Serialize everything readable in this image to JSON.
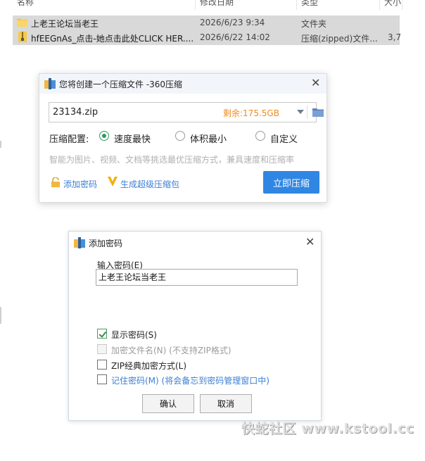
{
  "explorer": {
    "columns": [
      "名称",
      "修改日期",
      "类型",
      "大小"
    ],
    "rows": [
      {
        "name": "上老王论坛当老王",
        "date": "2026/6/23 9:34",
        "type": "文件夹",
        "size": ""
      },
      {
        "name": "hfEEGnAs_点击-她点击此处CLICK HER....",
        "date": "2026/6/22 14:02",
        "type": "压缩(zipped)文件...",
        "size": "3,7"
      }
    ]
  },
  "compress_dialog": {
    "title": "您将创建一个压缩文件 -360压缩",
    "filename": "23134.zip",
    "remaining": "剩余:175.5GB",
    "config_label": "压缩配置:",
    "options": [
      "速度最快",
      "体积最小",
      "自定义"
    ],
    "selected_option": "速度最快",
    "hint": "智能为图片、视频、文档等挑选最优压缩方式，兼具速度和压缩率",
    "add_password": "添加密码",
    "super_package": "生成超级压缩包",
    "compress_now": "立即压缩"
  },
  "password_dialog": {
    "title": "添加密码",
    "input_label": "输入密码(E)",
    "password_value": "上老王论坛当老王",
    "checkboxes": [
      {
        "label": "显示密码(S)",
        "checked": true,
        "enabled": true
      },
      {
        "label": "加密文件名(N) (不支持ZIP格式)",
        "checked": false,
        "enabled": false
      },
      {
        "label": "ZIP经典加密方式(L)",
        "checked": false,
        "enabled": true
      },
      {
        "label": "记住密码(M) (将会备忘到密码管理窗口中)",
        "checked": false,
        "enabled": true
      }
    ],
    "ok": "确认",
    "cancel": "取消"
  },
  "watermark": "快蛇社区 www.kstool.cc",
  "colors": {
    "accent": "#2f86e3",
    "remain": "#f08a1c",
    "radio_on": "#2d9c5c",
    "link": "#3b7fd4"
  }
}
